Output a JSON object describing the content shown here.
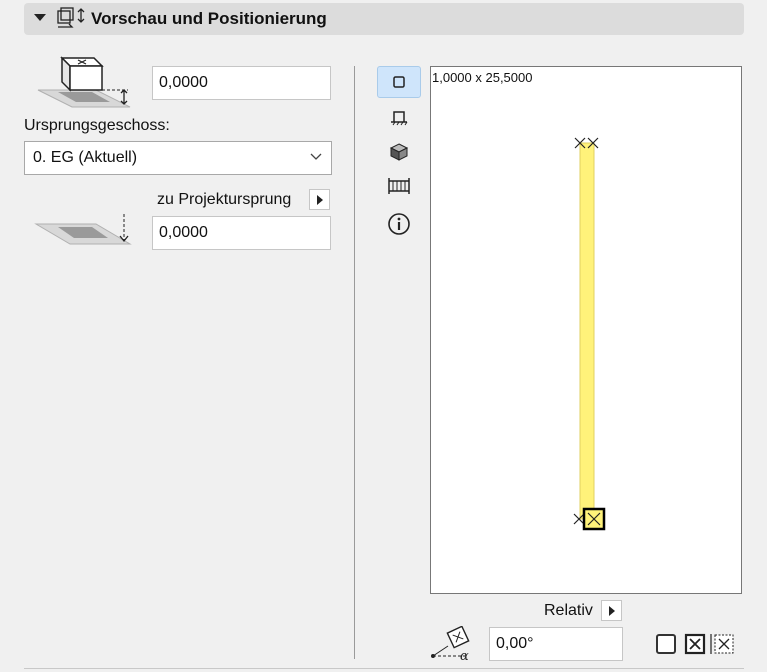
{
  "panel": {
    "title": "Vorschau und Positionierung"
  },
  "left": {
    "top_offset_value": "0,0000",
    "origin_floor_label": "Ursprungsgeschoss:",
    "origin_floor_selected": "0. EG (Aktuell)",
    "reference_label": "zu Projektursprung",
    "bottom_offset_value": "0,0000"
  },
  "preview": {
    "dimensions_text": "1,0000 x 25,5000",
    "relative_label": "Relativ",
    "angle_value": "0,00°",
    "element_color": "#fff27a"
  },
  "tools": [
    {
      "icon": "plan-view-icon",
      "active": true
    },
    {
      "icon": "section-view-icon",
      "active": false
    },
    {
      "icon": "3d-view-icon",
      "active": false
    },
    {
      "icon": "elevation-view-icon",
      "active": false
    },
    {
      "icon": "info-icon",
      "active": false
    }
  ]
}
